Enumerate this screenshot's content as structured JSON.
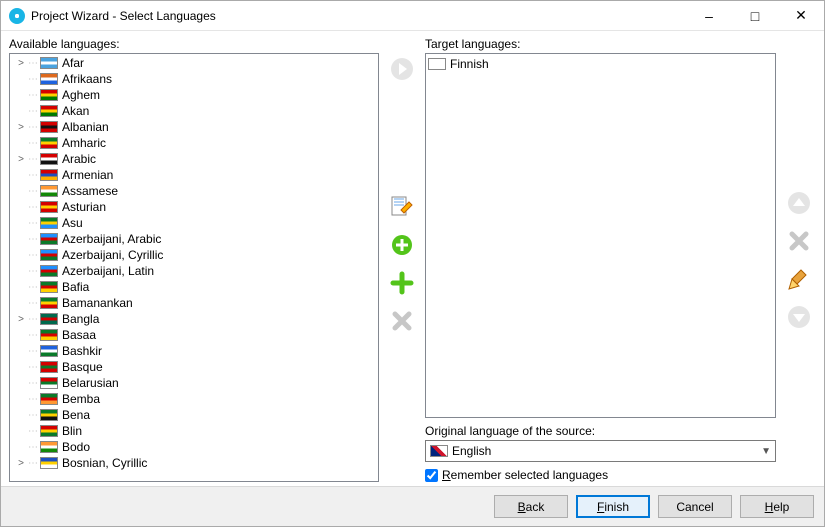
{
  "window": {
    "title": "Project Wizard - Select Languages"
  },
  "labels": {
    "available": "Available languages:",
    "target": "Target languages:",
    "source": "Original language of the source:",
    "remember": "Remember selected languages"
  },
  "available_languages": [
    {
      "label": "Afar",
      "expandable": true
    },
    {
      "label": "Afrikaans",
      "expandable": false
    },
    {
      "label": "Aghem",
      "expandable": false
    },
    {
      "label": "Akan",
      "expandable": false
    },
    {
      "label": "Albanian",
      "expandable": true
    },
    {
      "label": "Amharic",
      "expandable": false
    },
    {
      "label": "Arabic",
      "expandable": true
    },
    {
      "label": "Armenian",
      "expandable": false
    },
    {
      "label": "Assamese",
      "expandable": false
    },
    {
      "label": "Asturian",
      "expandable": false
    },
    {
      "label": "Asu",
      "expandable": false
    },
    {
      "label": "Azerbaijani, Arabic",
      "expandable": false
    },
    {
      "label": "Azerbaijani, Cyrillic",
      "expandable": false
    },
    {
      "label": "Azerbaijani, Latin",
      "expandable": false
    },
    {
      "label": "Bafia",
      "expandable": false
    },
    {
      "label": "Bamanankan",
      "expandable": false
    },
    {
      "label": "Bangla",
      "expandable": true
    },
    {
      "label": "Basaa",
      "expandable": false
    },
    {
      "label": "Bashkir",
      "expandable": false
    },
    {
      "label": "Basque",
      "expandable": false
    },
    {
      "label": "Belarusian",
      "expandable": false
    },
    {
      "label": "Bemba",
      "expandable": false
    },
    {
      "label": "Bena",
      "expandable": false
    },
    {
      "label": "Blin",
      "expandable": false
    },
    {
      "label": "Bodo",
      "expandable": false
    },
    {
      "label": "Bosnian, Cyrillic",
      "expandable": true
    }
  ],
  "flag_colors": [
    [
      "#4aa3df",
      "#fff",
      "#4aa3df"
    ],
    [
      "#de6a1e",
      "#fff",
      "#1e62de"
    ],
    [
      "#d40000",
      "#ffd000",
      "#007a00"
    ],
    [
      "#d40000",
      "#ffd000",
      "#007a00"
    ],
    [
      "#d40000",
      "#111",
      "#d40000"
    ],
    [
      "#0a7a2a",
      "#ffd000",
      "#d40000"
    ],
    [
      "#d40000",
      "#fff",
      "#111"
    ],
    [
      "#d40000",
      "#1e4fbf",
      "#ffb000"
    ],
    [
      "#ff9933",
      "#fff",
      "#138808"
    ],
    [
      "#d40000",
      "#ffd000",
      "#d40000"
    ],
    [
      "#0a7a2a",
      "#ffd000",
      "#1e90ff"
    ],
    [
      "#1e90ff",
      "#d40000",
      "#0a7a2a"
    ],
    [
      "#1e90ff",
      "#d40000",
      "#0a7a2a"
    ],
    [
      "#1e90ff",
      "#d40000",
      "#0a7a2a"
    ],
    [
      "#0a7a2a",
      "#d40000",
      "#ffd000"
    ],
    [
      "#0a7a2a",
      "#ffd000",
      "#d40000"
    ],
    [
      "#006a4e",
      "#d40000",
      "#006a4e"
    ],
    [
      "#0a7a2a",
      "#d40000",
      "#ffd000"
    ],
    [
      "#1e62de",
      "#fff",
      "#0a7a2a"
    ],
    [
      "#d40000",
      "#0a7a2a",
      "#d40000"
    ],
    [
      "#d40000",
      "#0a7a2a",
      "#fff"
    ],
    [
      "#0a7a2a",
      "#d40000",
      "#ff9933"
    ],
    [
      "#0a7a2a",
      "#ffd000",
      "#111"
    ],
    [
      "#d40000",
      "#ffd000",
      "#0a7a2a"
    ],
    [
      "#ff9933",
      "#fff",
      "#138808"
    ],
    [
      "#1e4fbf",
      "#ffd000",
      "#fff"
    ]
  ],
  "target_languages": [
    {
      "label": "Finnish"
    }
  ],
  "source_language": {
    "selected": "English"
  },
  "remember_checked": true,
  "buttons": {
    "back": "Back",
    "finish": "Finish",
    "cancel": "Cancel",
    "help": "Help"
  },
  "mid_icons": {
    "arrow": "move-right-icon",
    "edit": "edit-pencil-icon",
    "add_circle": "add-circle-icon",
    "add_plus": "add-plus-icon",
    "remove": "remove-x-icon"
  },
  "far_icons": {
    "up": "move-up-icon",
    "delete": "delete-x-icon",
    "broom": "clear-broom-icon",
    "down": "move-down-icon"
  }
}
